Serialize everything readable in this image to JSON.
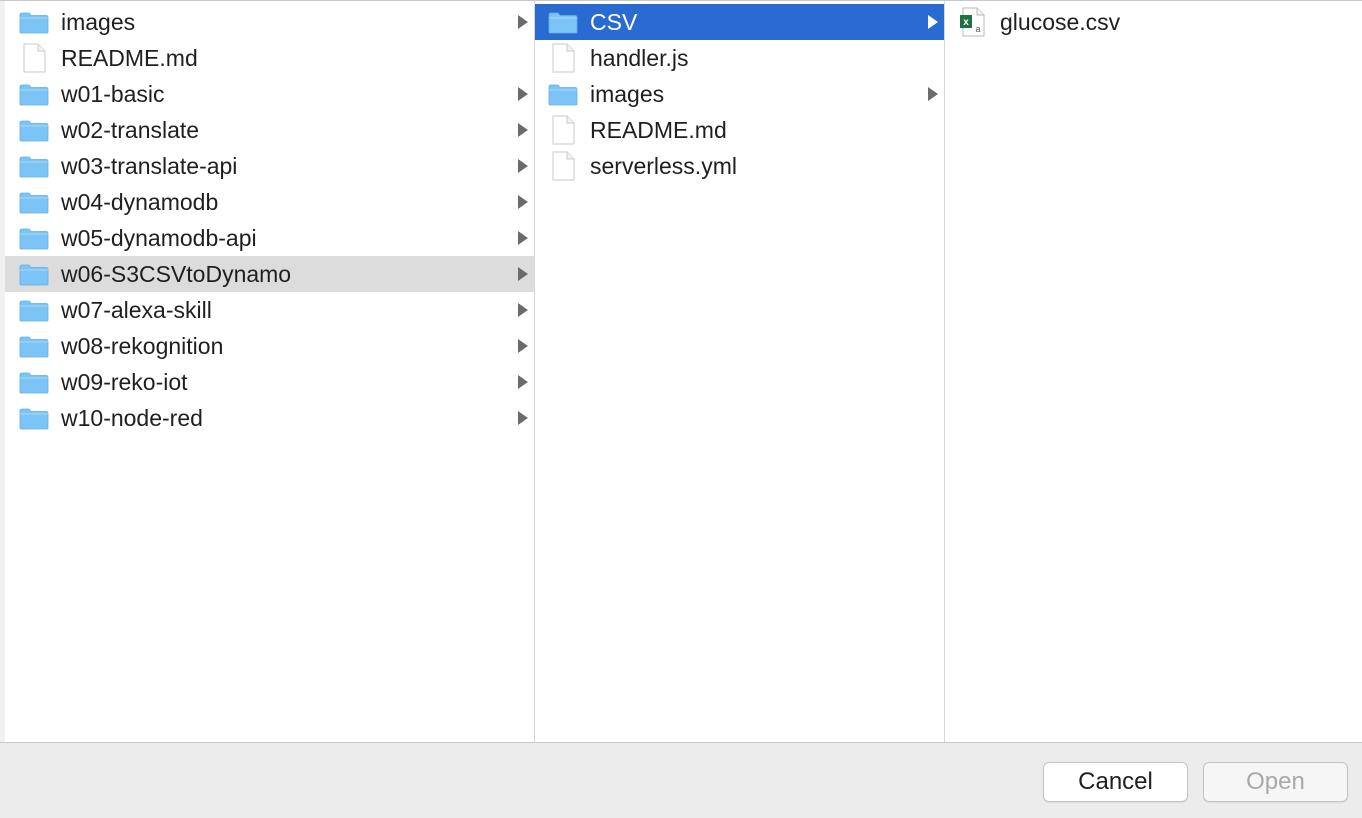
{
  "column1": {
    "items": [
      {
        "label": "images",
        "type": "folder",
        "has_children": true,
        "selected": ""
      },
      {
        "label": "README.md",
        "type": "file",
        "has_children": false,
        "selected": ""
      },
      {
        "label": "w01-basic",
        "type": "folder",
        "has_children": true,
        "selected": ""
      },
      {
        "label": "w02-translate",
        "type": "folder",
        "has_children": true,
        "selected": ""
      },
      {
        "label": "w03-translate-api",
        "type": "folder",
        "has_children": true,
        "selected": ""
      },
      {
        "label": "w04-dynamodb",
        "type": "folder",
        "has_children": true,
        "selected": ""
      },
      {
        "label": "w05-dynamodb-api",
        "type": "folder",
        "has_children": true,
        "selected": ""
      },
      {
        "label": "w06-S3CSVtoDynamo",
        "type": "folder",
        "has_children": true,
        "selected": "gray"
      },
      {
        "label": "w07-alexa-skill",
        "type": "folder",
        "has_children": true,
        "selected": ""
      },
      {
        "label": "w08-rekognition",
        "type": "folder",
        "has_children": true,
        "selected": ""
      },
      {
        "label": "w09-reko-iot",
        "type": "folder",
        "has_children": true,
        "selected": ""
      },
      {
        "label": "w10-node-red",
        "type": "folder",
        "has_children": true,
        "selected": ""
      }
    ]
  },
  "column2": {
    "items": [
      {
        "label": "CSV",
        "type": "folder",
        "has_children": true,
        "selected": "blue"
      },
      {
        "label": "handler.js",
        "type": "file",
        "has_children": false,
        "selected": ""
      },
      {
        "label": "images",
        "type": "folder",
        "has_children": true,
        "selected": ""
      },
      {
        "label": "README.md",
        "type": "file",
        "has_children": false,
        "selected": ""
      },
      {
        "label": "serverless.yml",
        "type": "file",
        "has_children": false,
        "selected": ""
      }
    ]
  },
  "column3": {
    "items": [
      {
        "label": "glucose.csv",
        "type": "csv",
        "has_children": false,
        "selected": ""
      }
    ]
  },
  "footer": {
    "cancel_label": "Cancel",
    "open_label": "Open"
  },
  "colors": {
    "selection_blue": "#2a6bd1",
    "selection_gray": "#dcdcdc",
    "folder_blue": "#7cc4f5",
    "excel_green": "#1f7244"
  }
}
